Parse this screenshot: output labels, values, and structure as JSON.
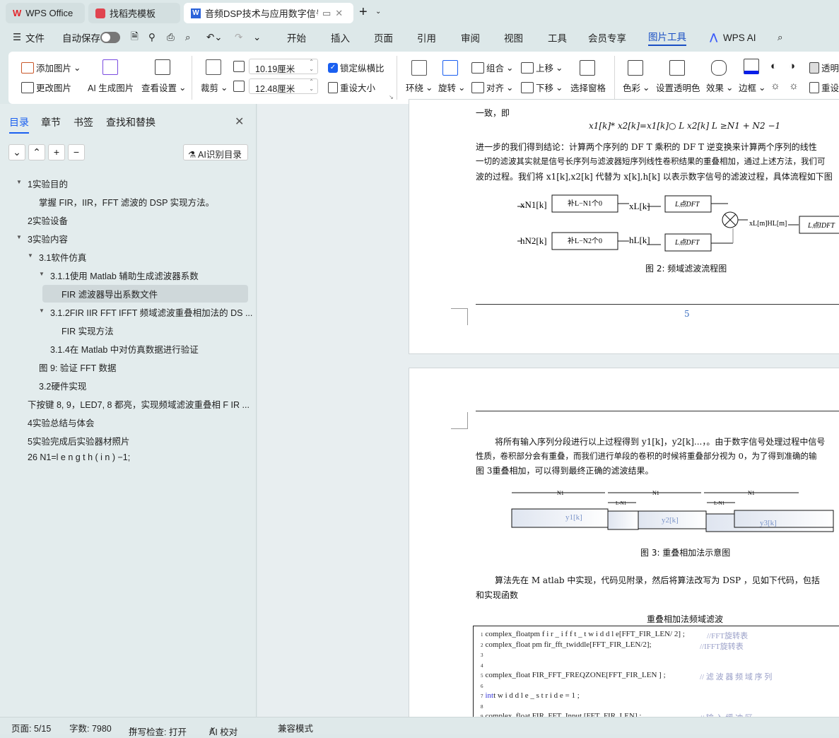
{
  "tabs": [
    {
      "label": "WPS Office",
      "icon": "wps-logo"
    },
    {
      "label": "找稻壳模板",
      "icon": "docer-logo"
    },
    {
      "label": "音频DSP技术与应用数字信号",
      "icon": "word-doc-icon",
      "active": true
    }
  ],
  "menu": {
    "file": "文件",
    "autosave": "自动保存",
    "autosave_on": false,
    "items": [
      "开始",
      "插入",
      "页面",
      "引用",
      "审阅",
      "视图",
      "工具",
      "会员专享",
      "图片工具",
      "WPS AI"
    ],
    "active": "图片工具"
  },
  "ribbon": {
    "add_image": "添加图片",
    "change_image": "更改图片",
    "ai_generate": "AI 生成图片",
    "view_settings": "查看设置",
    "crop": "裁剪",
    "width": "10.19厘米",
    "height": "12.48厘米",
    "lock_ratio": "锁定纵横比",
    "lock_ratio_checked": true,
    "reset_size": "重设大小",
    "wrap": "环绕",
    "rotate": "旋转",
    "group": "组合",
    "align": "对齐",
    "bring_forward": "上移",
    "send_backward": "下移",
    "selection_pane": "选择窗格",
    "color": "色彩",
    "set_transparent": "设置透明色",
    "effects": "效果",
    "border": "边框",
    "transparency": "透明",
    "reset": "重设",
    "border_color": "#0a1ee8"
  },
  "sidebar": {
    "tabs": [
      "目录",
      "章节",
      "书签",
      "查找和替换"
    ],
    "active_tab": "目录",
    "ai_toc": "AI识别目录",
    "items": [
      {
        "label": "1实验目的",
        "level": 0,
        "expanded": true
      },
      {
        "label": "掌握 FIR，IIR，FFT 滤波的 DSP 实现方法。",
        "level": 1
      },
      {
        "label": "2实验设备",
        "level": 0
      },
      {
        "label": "3实验内容",
        "level": 0,
        "expanded": true
      },
      {
        "label": "3.1软件仿真",
        "level": 1,
        "expanded": true
      },
      {
        "label": "3.1.1使用 Matlab 辅助生成滤波器系数",
        "level": 2,
        "expanded": true
      },
      {
        "label": "FIR 滤波器导出系数文件",
        "level": 3,
        "selected": true
      },
      {
        "label": "3.1.2FIR IIR FFT IFFT 频域滤波重叠相加法的 DS ...",
        "level": 2,
        "expanded": true
      },
      {
        "label": "FIR 实现方法",
        "level": 3
      },
      {
        "label": "3.1.4在 Matlab 中对仿真数据进行验证",
        "level": 2
      },
      {
        "label": "图 9: 验证 FFT 数据",
        "level": 1
      },
      {
        "label": "3.2硬件实现",
        "level": 1
      },
      {
        "label": "下按键 8, 9，LED7, 8 都亮，实现频域滤波重叠相 F IR ...",
        "level": 0
      },
      {
        "label": "4实验总结与体会",
        "level": 0
      },
      {
        "label": "5实验完成后实验器材照片",
        "level": 0
      },
      {
        "label": "26  N1=l e n g t h ( i n ) −1;",
        "level": 0
      }
    ]
  },
  "doc": {
    "p1_line0": "一致，即",
    "formula": "x1[k]*  x2[k]=x1[k]○ L x2[k]     L ≥N1 + N2 −1",
    "p1_line1": "进一步的我们得到结论：计算两个序列的 DF T 乘积的 DF T 逆变换来计算两个序列的线性",
    "p1_line2": "一切的滤波其实就是信号长序列与滤波器短序列线性卷积结果的重叠相加，通过上述方法，我们可",
    "p1_line3": "波的过程。我们将 x1[k],x2[k] 代替为 x[k],h[k] 以表示数字信号的滤波过程，具体流程如下图",
    "fig2": {
      "x_in": "xN1[k]",
      "h_in": "hN2[k]",
      "pad1": "补L−N1个0",
      "pad2": "补L−N2个0",
      "xl": "xL[k]",
      "hl": "hL[k]",
      "dft": "L点DFT",
      "mult": "xL[m]HL[m]",
      "idft": "L点IDFT",
      "caption": "图 2: 频域滤波流程图"
    },
    "page_number": "5",
    "p2_line1": "将所有输入序列分段进行以上过程得到 y1[k]，y2[k]...，。由于数字信号处理过程中信号",
    "p2_line2": "性质，卷积部分会有重叠，而我们进行单段的卷积的时候将重叠部分视为  0，为了得到准确的输",
    "p2_line3": "图 3重叠相加，可以得到最终正确的滤波结果。",
    "fig3": {
      "n1": "N1",
      "lmn": "L-N1",
      "y1": "y1[k]",
      "y2": "y2[k]",
      "y3": "y3[k]",
      "caption": "图 3: 重叠相加法示意图"
    },
    "p3_line1": "算法先在 M atlab 中实现，代码见附录，然后将算法改写为 DSP ，见如下代码，包括",
    "p3_line2": "和实现函数",
    "code_title": "重叠相加法频域滤波",
    "code": [
      {
        "n": "1",
        "text": "complex_floatpm f i r _ i f f t _ t w i d d l e[FFT_FIR_LEN/ 2] ;",
        "comment": "//FFT旋转表"
      },
      {
        "n": "2",
        "text": "complex_float pm fir_fft_twiddle[FFT_FIR_LEN/2];",
        "comment": "//IFFT旋转表"
      },
      {
        "n": "3",
        "text": "",
        "comment": ""
      },
      {
        "n": "4",
        "text": "",
        "comment": ""
      },
      {
        "n": "5",
        "text": "complex_float FIR_FFT_FREQZONE[FFT_FIR_LEN ] ;",
        "comment": "// 滤 波 器 频 域 序 列"
      },
      {
        "n": "6",
        "text": "",
        "comment": ""
      },
      {
        "n": "7",
        "kw": "int",
        "text": "t w i d d l e _ s t r i d e = 1 ;",
        "comment": ""
      },
      {
        "n": "8",
        "text": "",
        "comment": ""
      },
      {
        "n": "9",
        "text": "complex_float  FIR_FFT_Input [FFT_FIR_LEN] ;",
        "comment": "// 输 入 缓 冲 区"
      }
    ]
  },
  "status": {
    "page": "页面: 5/15",
    "words": "字数: 7980",
    "spell": "拼写检查: 打开",
    "ai_proof": "AI 校对",
    "compat": "兼容模式"
  }
}
